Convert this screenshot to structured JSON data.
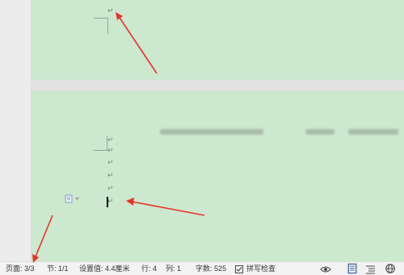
{
  "theme": {
    "page_color": "#cce8cf",
    "gutter_color": "#ececec",
    "arrow_color": "#e8332a"
  },
  "status_bar": {
    "page": "页面: 3/3",
    "section": "节: 1/1",
    "position": "设置值: 4.4厘米",
    "row": "行: 4",
    "column": "列: 1",
    "word_count": "字数: 525",
    "spell_check": "拼写检查"
  },
  "icons": {
    "spell_check": "checkbox-check-icon",
    "reading_mode": "eye-icon",
    "page_view": "page-view-icon",
    "outline_view": "outline-view-icon",
    "web_view": "globe-icon",
    "paste_options": "paste-options-icon"
  },
  "document": {
    "paragraph_mark": "↵"
  }
}
